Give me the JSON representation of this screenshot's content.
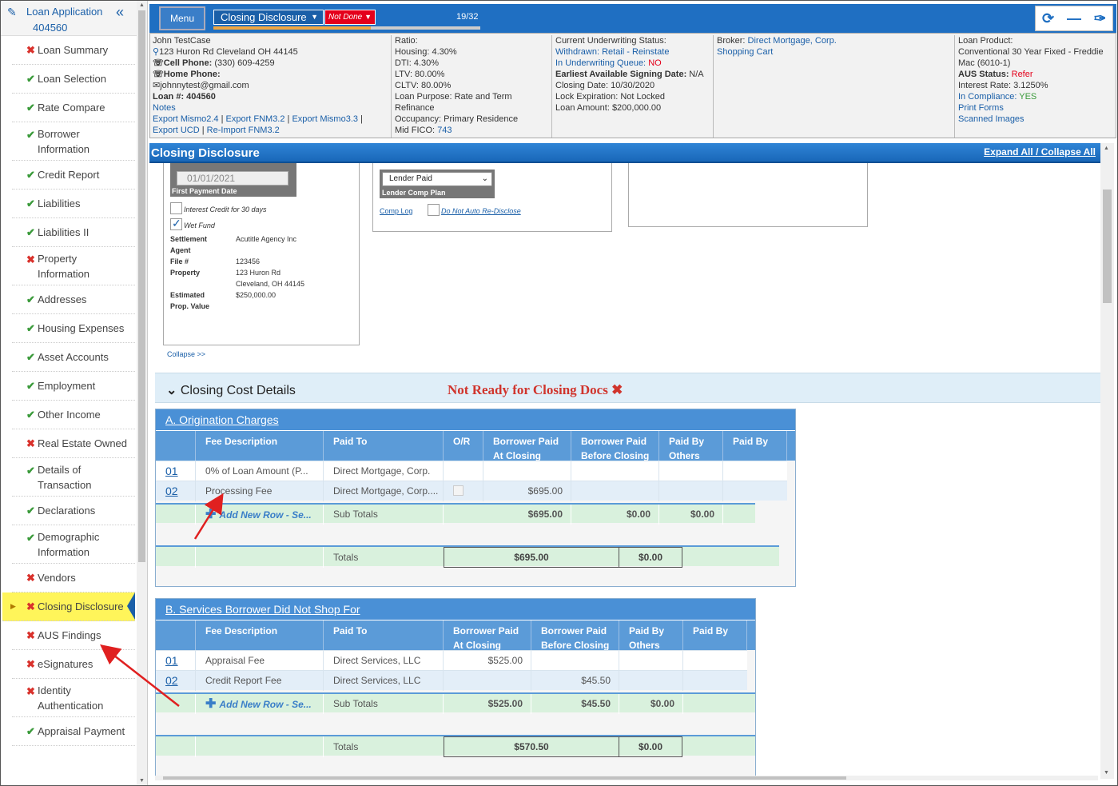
{
  "sidebar": {
    "title_line1": "Loan Application",
    "title_line2": "404560",
    "items": [
      {
        "label": "Loan Summary",
        "status": "bad"
      },
      {
        "label": "Loan Selection",
        "status": "ok"
      },
      {
        "label": "Rate Compare",
        "status": "ok"
      },
      {
        "label": "Borrower Information",
        "status": "ok",
        "two": true
      },
      {
        "label": "Credit Report",
        "status": "ok"
      },
      {
        "label": "Liabilities",
        "status": "ok"
      },
      {
        "label": "Liabilities II",
        "status": "ok"
      },
      {
        "label": "Property Information",
        "status": "bad",
        "two": true
      },
      {
        "label": "Addresses",
        "status": "ok"
      },
      {
        "label": "Housing Expenses",
        "status": "ok"
      },
      {
        "label": "Asset Accounts",
        "status": "ok"
      },
      {
        "label": "Employment",
        "status": "ok"
      },
      {
        "label": "Other Income",
        "status": "ok"
      },
      {
        "label": "Real Estate Owned",
        "status": "bad"
      },
      {
        "label": "Details of Transaction",
        "status": "ok",
        "two": true
      },
      {
        "label": "Declarations",
        "status": "ok"
      },
      {
        "label": "Demographic Information",
        "status": "ok",
        "two": true
      },
      {
        "label": "Vendors",
        "status": "bad"
      },
      {
        "label": "Closing Disclosure",
        "status": "bad",
        "active": true
      },
      {
        "label": "AUS Findings",
        "status": "bad"
      },
      {
        "label": "eSignatures",
        "status": "bad"
      },
      {
        "label": "Identity Authentication",
        "status": "bad",
        "two": true
      },
      {
        "label": "Appraisal Payment",
        "status": "ok"
      }
    ]
  },
  "topbar": {
    "menu_label": "Menu",
    "page_select": "Closing Disclosure",
    "status_select": "Not Done",
    "progress_text": "19/32",
    "progress_fraction": 0.59
  },
  "info": {
    "borrower_name": "John TestCase",
    "address": "123 Huron Rd Cleveland OH 44145",
    "cell_label": "Cell Phone:",
    "cell_value": "(330) 609-4259",
    "home_label": "Home Phone:",
    "email": "johnnytest@gmail.com",
    "loan_label": "Loan #: 404560",
    "notes": "Notes",
    "export_mismo24": "Export Mismo2.4",
    "export_fnm32": "Export FNM3.2",
    "export_mismo33": "Export Mismo3.3",
    "export_ucd": "Export UCD",
    "reimport": "Re-Import FNM3.2",
    "ratio_label": "Ratio:",
    "housing": "Housing: 4.30%",
    "dti": "DTI: 4.30%",
    "ltv": "LTV: 80.00%",
    "cltv": "CLTV: 80.00%",
    "purpose": "Loan Purpose: Rate and Term",
    "purpose2": "Refinance",
    "occupancy": "Occupancy: Primary Residence",
    "fico_label": "Mid FICO:",
    "fico_value": "743",
    "uw_label": "Current Underwriting Status:",
    "uw_status": "Withdrawn: Retail - Reinstate",
    "uw_queue_label": "In Underwriting Queue:",
    "uw_queue_value": "NO",
    "signing_label": "Earliest Available Signing Date:",
    "signing_value": "N/A",
    "closing_date": "Closing Date: 10/30/2020",
    "lock": "Lock Expiration: Not Locked",
    "amount": "Loan Amount: $200,000.00",
    "broker_label": "Broker:",
    "broker_value": "Direct Mortgage, Corp.",
    "shopping_cart": "Shopping Cart",
    "product_label": "Loan Product:",
    "product_value": "Conventional 30 Year Fixed - Freddie Mac (6010-1)",
    "aus_label": "AUS Status:",
    "aus_value": "Refer",
    "interest": "Interest Rate: 3.1250%",
    "compliance_label": "In Compliance:",
    "compliance_value": "YES",
    "print_forms": "Print Forms",
    "scanned": "Scanned Images"
  },
  "section": {
    "title": "Closing Disclosure",
    "expand_all": "Expand All",
    "sep": "/",
    "collapse_all": "Collapse All"
  },
  "details": {
    "first_payment_value": "01/01/2021",
    "first_payment_label": "First Payment Date",
    "interest_credit": "Interest Credit for 30 days",
    "wet_fund": "Wet Fund",
    "settlement_label": "Settlement",
    "agent_label": "Agent",
    "settlement_value": "Acutitle Agency Inc",
    "file_label": "File #",
    "file_value": "123456",
    "property_label": "Property",
    "property_line1": "123 Huron Rd",
    "property_line2": "Cleveland, OH 44145",
    "est_label1": "Estimated",
    "est_label2": "Prop. Value",
    "est_value": "$250,000.00",
    "collapse": "Collapse >>",
    "lender_paid": "Lender Paid",
    "lender_comp_label": "Lender Comp Plan",
    "comp_log": "Comp Log",
    "no_auto": "Do Not Auto Re-Disclose"
  },
  "ccd": {
    "title": "Closing Cost Details",
    "warning": "Not Ready for Closing Docs"
  },
  "tableA": {
    "title": "A. Origination Charges",
    "headers": [
      "Fee Description",
      "Paid To",
      "O/R",
      "Borrower Paid At Closing",
      "Borrower Paid Before Closing",
      "Paid By Others",
      "Paid By"
    ],
    "rows": [
      {
        "num": "01",
        "desc": "0% of Loan Amount (P...",
        "paid_to": "Direct Mortgage, Corp.",
        "at_closing": "",
        "before": ""
      },
      {
        "num": "02",
        "desc": "Processing Fee",
        "paid_to": "Direct Mortgage, Corp....",
        "at_closing": "$695.00",
        "before": ""
      }
    ],
    "add_new": "Add New Row - Se...",
    "subtotal_label": "Sub Totals",
    "sub_at": "$695.00",
    "sub_before": "$0.00",
    "sub_others": "$0.00",
    "totals_label": "Totals",
    "tot1": "$695.00",
    "tot2": "$0.00"
  },
  "tableB": {
    "title": "B. Services Borrower Did Not Shop For",
    "headers": [
      "Fee Description",
      "Paid To",
      "Borrower Paid At Closing",
      "Borrower Paid Before Closing",
      "Paid By Others",
      "Paid By"
    ],
    "rows": [
      {
        "num": "01",
        "desc": "Appraisal Fee",
        "paid_to": "Direct Services, LLC",
        "at_closing": "$525.00",
        "before": ""
      },
      {
        "num": "02",
        "desc": "Credit Report Fee",
        "paid_to": "Direct Services, LLC",
        "at_closing": "",
        "before": "$45.50"
      }
    ],
    "add_new": "Add New Row - Se...",
    "subtotal_label": "Sub Totals",
    "sub_at": "$525.00",
    "sub_before": "$45.50",
    "sub_others": "$0.00",
    "totals_label": "Totals",
    "tot1": "$570.50",
    "tot2": "$0.00"
  },
  "colors": {
    "accent": "#1f6fc2",
    "warning": "#d0342c",
    "ok": "#3a9a3a",
    "active": "#fff55a"
  }
}
